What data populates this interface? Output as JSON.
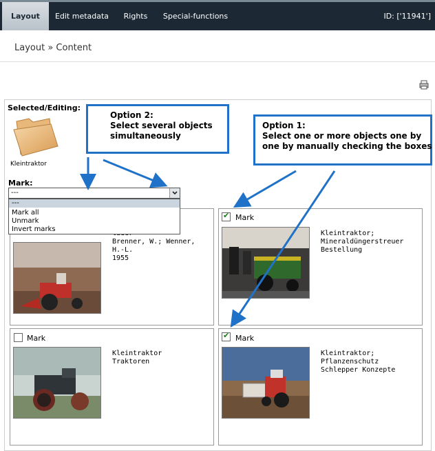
{
  "nav": {
    "tabs": [
      "Layout",
      "Edit metadata",
      "Rights",
      "Special-functions"
    ],
    "id_label": "ID: ['11941']"
  },
  "breadcrumb": "Layout » Content",
  "selected": {
    "title": "Selected/Editing:",
    "folder_caption": "Kleintraktor"
  },
  "mark": {
    "label": "Mark:",
    "selected_value": "---",
    "options": [
      "---",
      "Mark all",
      "Unmark",
      "Invert marks"
    ]
  },
  "cards": [
    {
      "checkbox_label": "",
      "checked": false,
      "text": "lader\nBrenner, W.; Wenner,\nH.-L.\n1955"
    },
    {
      "checkbox_label": "Mark",
      "checked": true,
      "text": "Kleintraktor;\nMineraldüngerstreuer\nBestellung"
    },
    {
      "checkbox_label": "Mark",
      "checked": false,
      "text": "Kleintraktor\nTraktoren"
    },
    {
      "checkbox_label": "Mark",
      "checked": true,
      "text": "Kleintraktor;\nPflanzenschutz\nSchlepper Konzepte"
    }
  ],
  "callouts": {
    "option2": {
      "title": "Option 2:",
      "body": "Select several objects\nsimultaneously"
    },
    "option1": {
      "title": "Option 1:",
      "body": "Select one or more objects one by\none by manually checking the boxes"
    }
  },
  "colors": {
    "topbar": "#1c2934",
    "callout_border": "#1f72c8",
    "check": "#1a7a1a"
  }
}
